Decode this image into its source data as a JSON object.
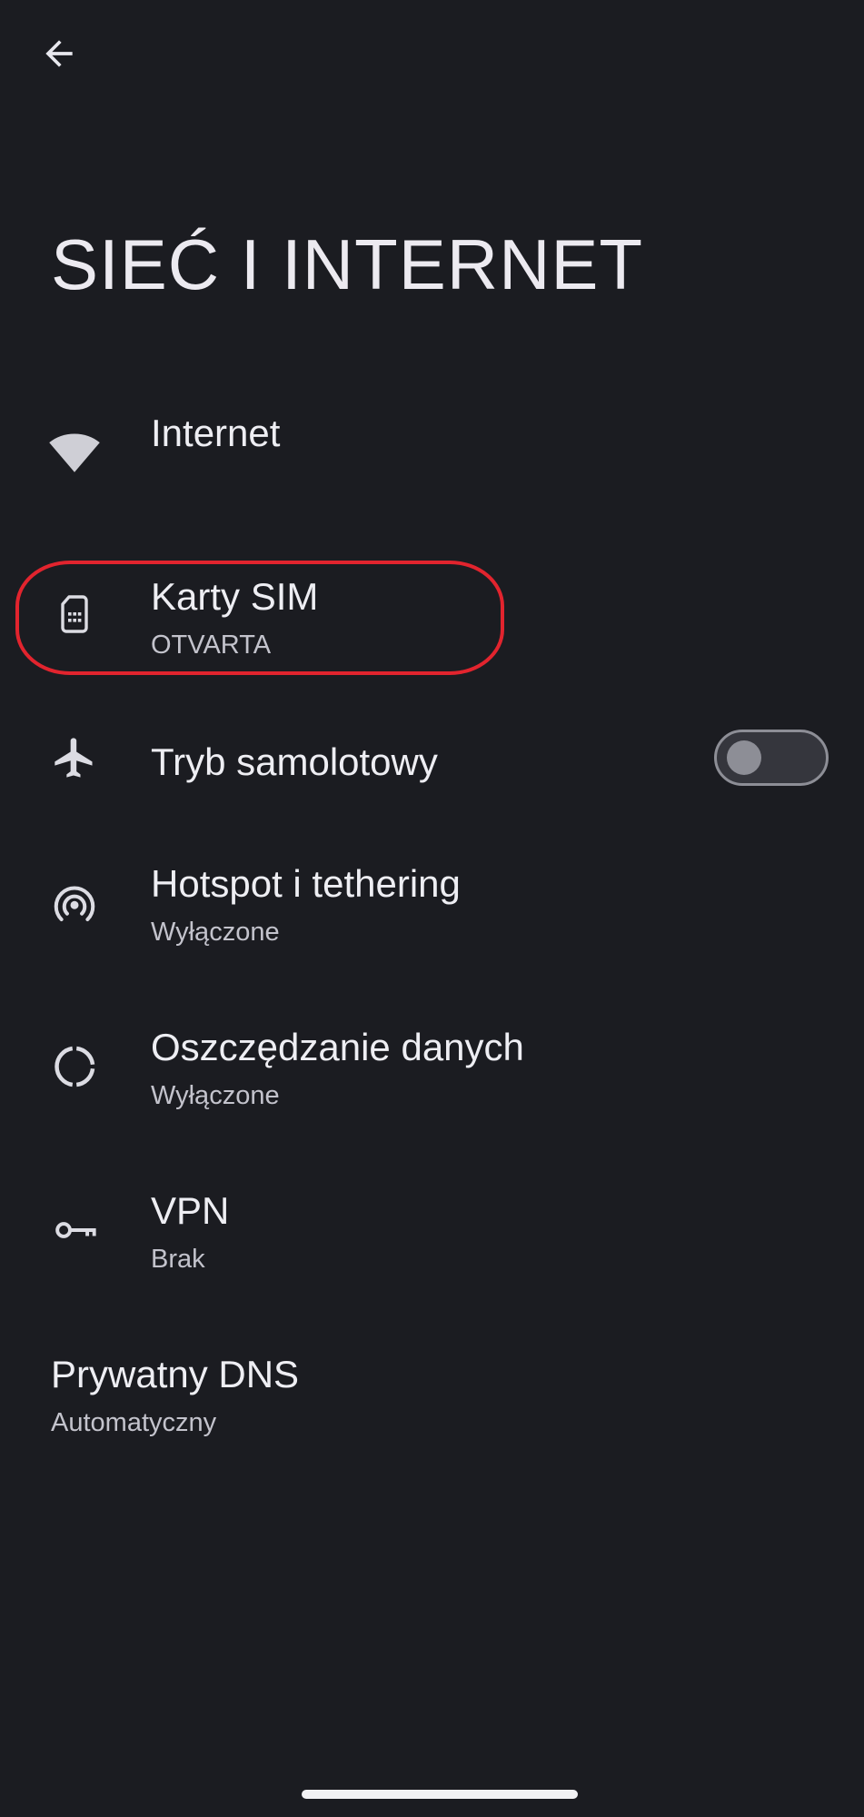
{
  "header": {
    "title": "SIEĆ I INTERNET",
    "back_icon": "arrow-left-icon"
  },
  "items": [
    {
      "label": "Internet",
      "sub": "",
      "icon": "wifi-icon"
    },
    {
      "label": "Karty SIM",
      "sub": "OTVARTA",
      "icon": "sim-card-icon"
    },
    {
      "label": "Tryb samolotowy",
      "sub": "",
      "icon": "airplane-icon",
      "toggle_on": false
    },
    {
      "label": "Hotspot i tethering",
      "sub": "Wyłączone",
      "icon": "hotspot-icon"
    },
    {
      "label": "Oszczędzanie danych",
      "sub": "Wyłączone",
      "icon": "data-saver-icon"
    },
    {
      "label": "VPN",
      "sub": "Brak",
      "icon": "vpn-key-icon"
    },
    {
      "label": "Prywatny DNS",
      "sub": "Automatyczny",
      "icon": ""
    }
  ],
  "colors": {
    "background": "#1b1c21",
    "highlight": "#e2242e",
    "icon": "#dcdce3"
  }
}
